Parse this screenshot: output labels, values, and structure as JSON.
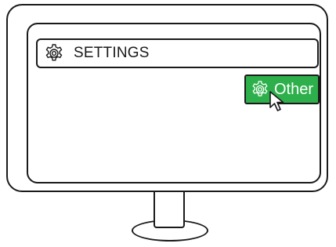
{
  "window": {
    "title": "SETTINGS",
    "title_icon": "gear-icon"
  },
  "button": {
    "label": "Other",
    "icon": "gear-icon",
    "color": "#2db04b",
    "text_color": "#ffffff"
  },
  "cursor": {
    "icon": "arrow-cursor-icon"
  }
}
